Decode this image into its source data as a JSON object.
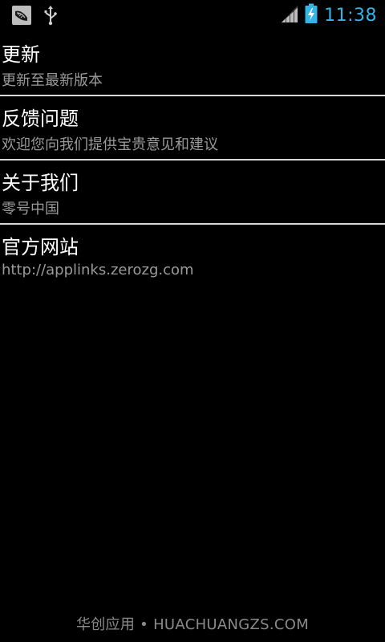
{
  "status_bar": {
    "time": "11:38",
    "icons": [
      "app-notification-icon",
      "usb-icon",
      "signal-icon",
      "battery-charging-icon"
    ],
    "accent_color": "#33b5e5"
  },
  "settings_list": [
    {
      "title": "更新",
      "subtitle": "更新至最新版本"
    },
    {
      "title": "反馈问题",
      "subtitle": "欢迎您向我们提供宝贵意见和建议"
    },
    {
      "title": "关于我们",
      "subtitle": "零号中国"
    },
    {
      "title": "官方网站",
      "subtitle": "http://applinks.zerozg.com"
    }
  ],
  "watermark": "华创应用 • HUACHUANGZS.COM"
}
